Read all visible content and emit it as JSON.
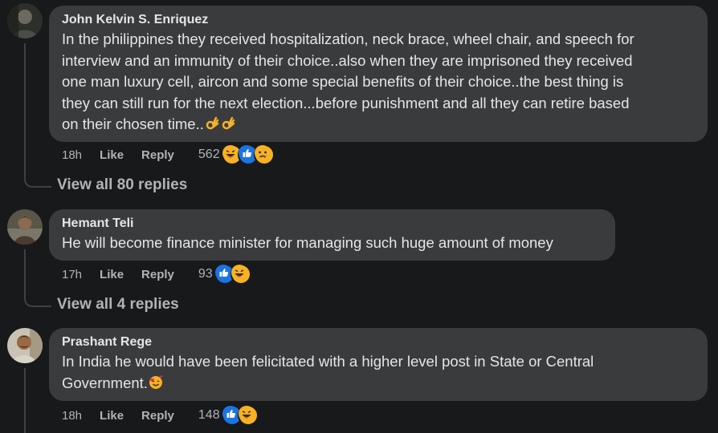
{
  "comments": [
    {
      "author": "John Kelvin S. Enriquez",
      "lines": [
        "In the philippines they received hospitalization, neck brace, wheel chair, and speech for",
        "interview and an immunity of their choice..also when they are imprisoned they received",
        "one man luxury cell, aircon and some special benefits of their choice..the best thing is",
        "they can still run for the next election...before punishment and all they can retire based",
        "on their chosen time.."
      ],
      "time": "18h",
      "like_label": "Like",
      "reply_label": "Reply",
      "reaction_count": "562",
      "reactions": [
        "haha",
        "like",
        "sad"
      ],
      "view_replies": "View all 80 replies"
    },
    {
      "author": "Hemant Teli",
      "lines": [
        "He will become finance minister for managing such huge amount of money"
      ],
      "time": "17h",
      "like_label": "Like",
      "reply_label": "Reply",
      "reaction_count": "93",
      "reactions": [
        "like",
        "haha"
      ],
      "view_replies": "View all 4 replies"
    },
    {
      "author": "Prashant Rege",
      "lines": [
        "In India he would have been felicitated with a higher level post in State or Central",
        "Government."
      ],
      "time": "18h",
      "like_label": "Like",
      "reply_label": "Reply",
      "reaction_count": "148",
      "reactions": [
        "like",
        "haha"
      ]
    }
  ],
  "colors": {
    "background": "#18191a",
    "bubble": "#3a3b3c",
    "text": "#e4e6eb",
    "muted": "#b0b3b8",
    "like_blue": "#1b74e4",
    "emoji_yellow": "#f7b125"
  }
}
